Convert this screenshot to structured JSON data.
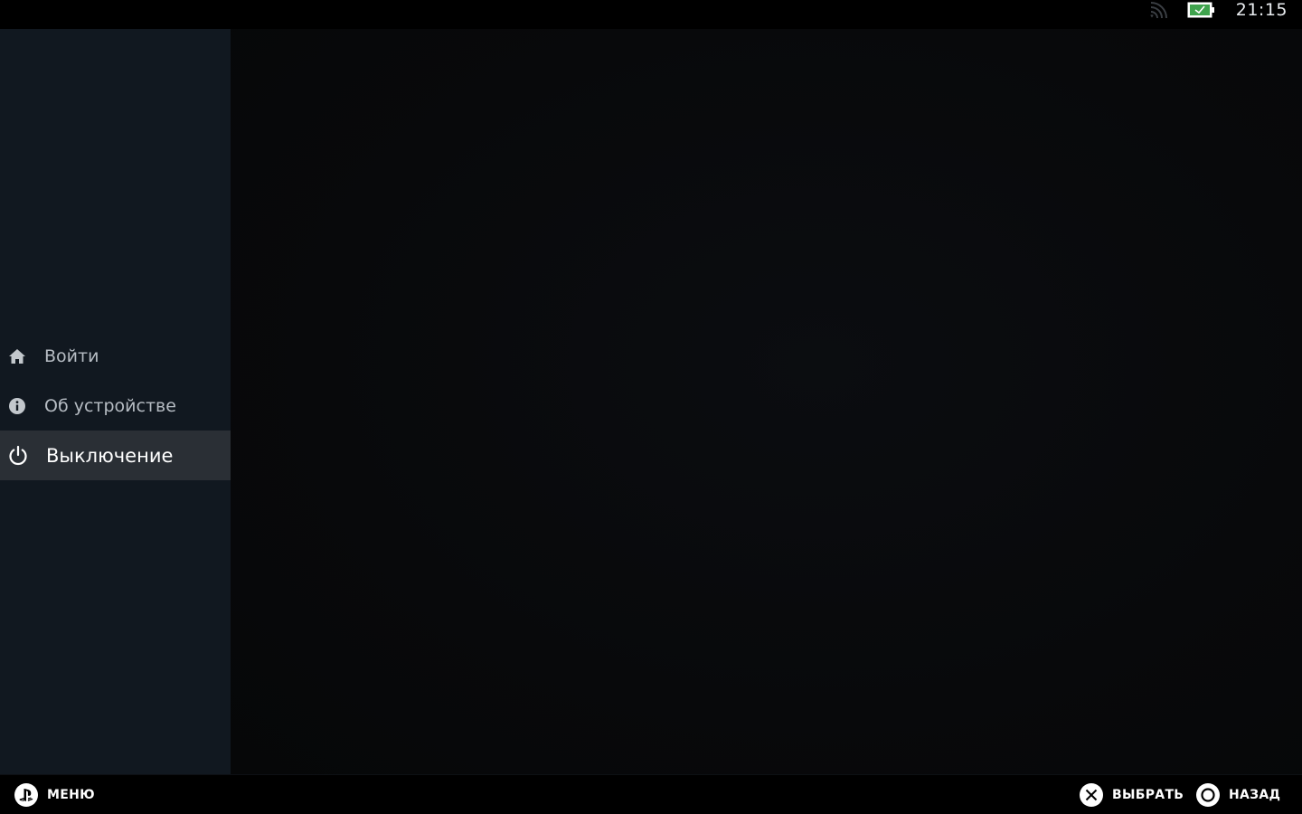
{
  "status_bar": {
    "time": "21:15",
    "wifi_icon": "wifi-icon",
    "battery_icon": "battery-charging-icon",
    "battery_color": "#4caf50"
  },
  "sidebar": {
    "items": [
      {
        "label": "Войти",
        "icon": "home-icon",
        "selected": false
      },
      {
        "label": "Об устройстве",
        "icon": "info-icon",
        "selected": false
      },
      {
        "label": "Выключение",
        "icon": "power-icon",
        "selected": true
      }
    ]
  },
  "bottom_bar": {
    "menu_label": "МЕНЮ",
    "menu_icon": "playstation-icon",
    "select_label": "ВЫБРАТЬ",
    "select_icon": "cross-button-icon",
    "back_label": "НАЗАД",
    "back_icon": "circle-button-icon"
  },
  "colors": {
    "sidebar_bg": "#111820",
    "selected_bg": "#2a2f35",
    "main_bg": "#08090b"
  }
}
